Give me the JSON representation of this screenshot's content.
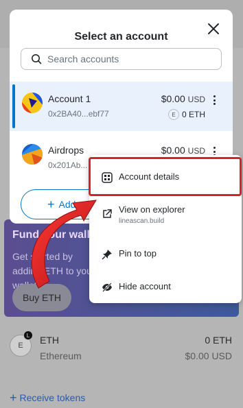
{
  "modal": {
    "title": "Select an account",
    "search_placeholder": "Search accounts",
    "add_account_label": "Add account"
  },
  "accounts": [
    {
      "name": "Account 1",
      "address": "0x2BA40...ebf77",
      "balance": "$0.00",
      "currency": "USD",
      "eth_amount": "0 ETH",
      "selected": true
    },
    {
      "name": "Airdrops",
      "address": "0x201Ab...",
      "balance": "$0.00",
      "currency": "USD",
      "selected": false
    }
  ],
  "menu": {
    "account_details": "Account details",
    "view_on_explorer": "View on explorer",
    "explorer_domain": "lineascan.build",
    "pin_to_top": "Pin to top",
    "hide_account": "Hide account"
  },
  "background": {
    "fund_title": "Fund your wallet",
    "fund_desc": "Get started by adding ETH to your wallet.",
    "buy_button": "Buy ETH",
    "token_name": "ETH",
    "token_network": "Ethereum",
    "token_amount": "0 ETH",
    "token_usd": "$0.00 USD",
    "receive_tokens": "Receive tokens",
    "token_icon_letter": "E",
    "token_badge_letter": "L"
  },
  "colors": {
    "accent": "#0376c9",
    "highlight": "#d0232e",
    "selected_row": "#e9f1fd"
  }
}
